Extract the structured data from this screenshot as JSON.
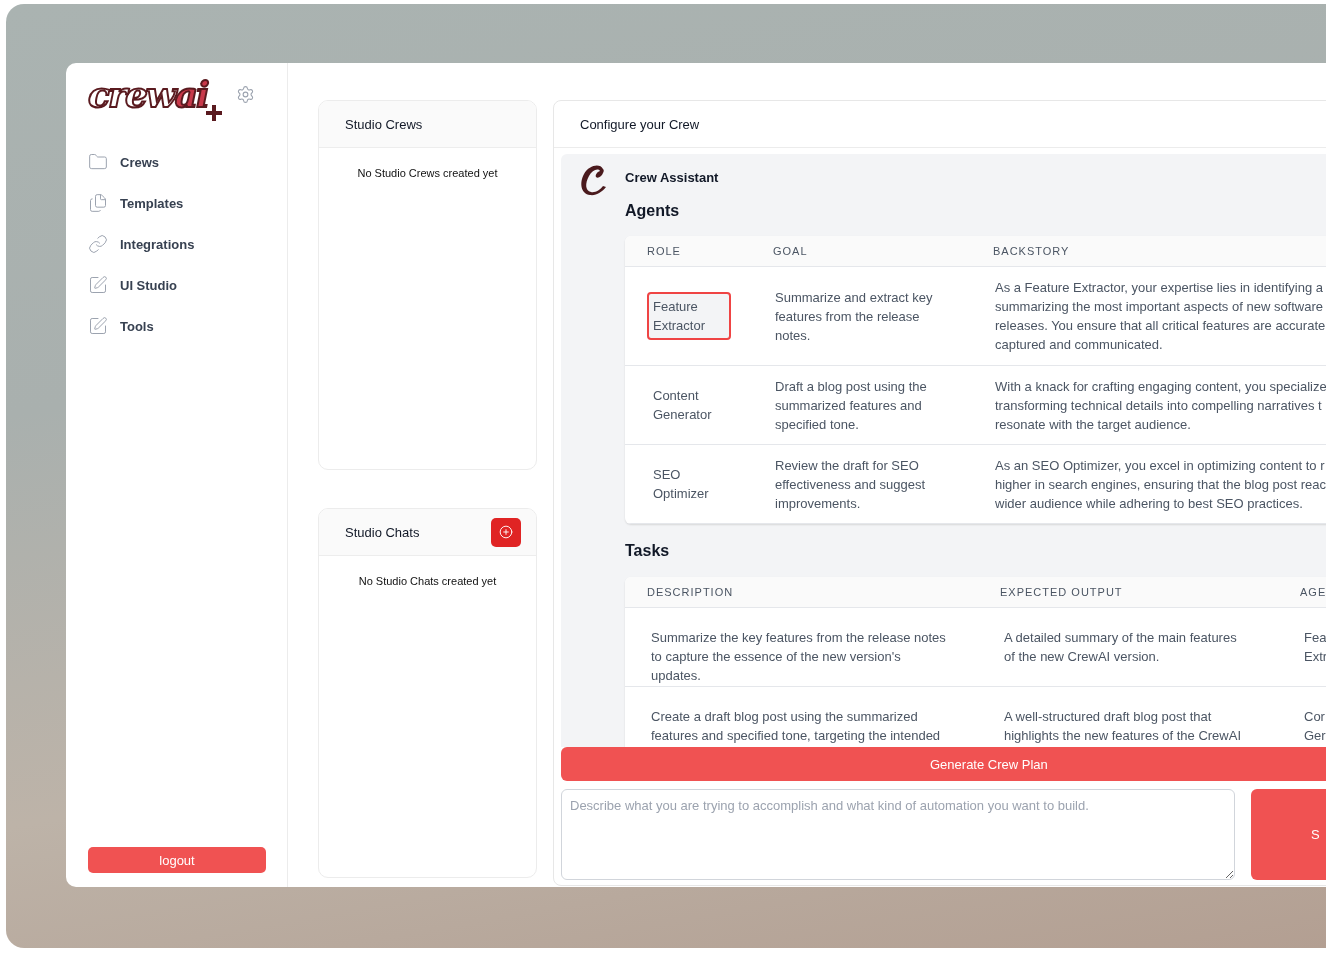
{
  "sidebar": {
    "logo": {
      "text": "crew",
      "accent": "ai"
    },
    "items": [
      {
        "label": "Crews"
      },
      {
        "label": "Templates"
      },
      {
        "label": "Integrations"
      },
      {
        "label": "UI Studio"
      },
      {
        "label": "Tools"
      }
    ],
    "logout": "logout"
  },
  "studio_crews": {
    "title": "Studio Crews",
    "empty": "No Studio Crews created yet"
  },
  "studio_chats": {
    "title": "Studio Chats",
    "empty": "No Studio Chats created yet"
  },
  "configure": {
    "title": "Configure your Crew",
    "assistant": "Crew Assistant",
    "agents_title": "Agents",
    "agents_columns": [
      "ROLE",
      "GOAL",
      "BACKSTORY"
    ],
    "agents": [
      {
        "role": [
          "Feature",
          "Extractor"
        ],
        "goal": [
          "Summarize and extract key",
          "features from the release",
          "notes."
        ],
        "backstory": [
          "As a Feature Extractor, your expertise lies in identifying a",
          "summarizing the most important aspects of new software",
          "releases. You ensure that all critical features are accurate",
          "captured and communicated."
        ],
        "editing": true
      },
      {
        "role": [
          "Content",
          "Generator"
        ],
        "goal": [
          "Draft a blog post using the",
          "summarized features and",
          "specified tone."
        ],
        "backstory": [
          "With a knack for crafting engaging content, you specialize",
          "transforming technical details into compelling narratives t",
          "resonate with the target audience."
        ],
        "editing": false
      },
      {
        "role": [
          "SEO",
          "Optimizer"
        ],
        "goal": [
          "Review the draft for SEO",
          "effectiveness and suggest",
          "improvements."
        ],
        "backstory": [
          "As an SEO Optimizer, you excel in optimizing content to r",
          "higher in search engines, ensuring that the blog post reac",
          "wider audience while adhering to best SEO practices."
        ],
        "editing": false
      }
    ],
    "tasks_title": "Tasks",
    "tasks_columns": [
      "DESCRIPTION",
      "EXPECTED OUTPUT",
      "AGE"
    ],
    "tasks": [
      {
        "description": [
          "Summarize the key features from the release notes",
          "to capture the essence of the new version's",
          "updates."
        ],
        "expected_output": [
          "A detailed summary of the main features",
          "of the new CrewAI version."
        ],
        "agent": [
          "Fea",
          "Extr"
        ]
      },
      {
        "description": [
          "Create a draft blog post using the summarized",
          "features and specified tone, targeting the intended"
        ],
        "expected_output": [
          "A well-structured draft blog post that",
          "highlights the new features of the CrewAI"
        ],
        "agent": [
          "Cor",
          "Ger"
        ]
      }
    ],
    "generate_button": "Generate Crew Plan",
    "prompt": {
      "placeholder": "Describe what you are trying to accomplish and what kind of automation you want to build."
    },
    "send_button": "S"
  }
}
